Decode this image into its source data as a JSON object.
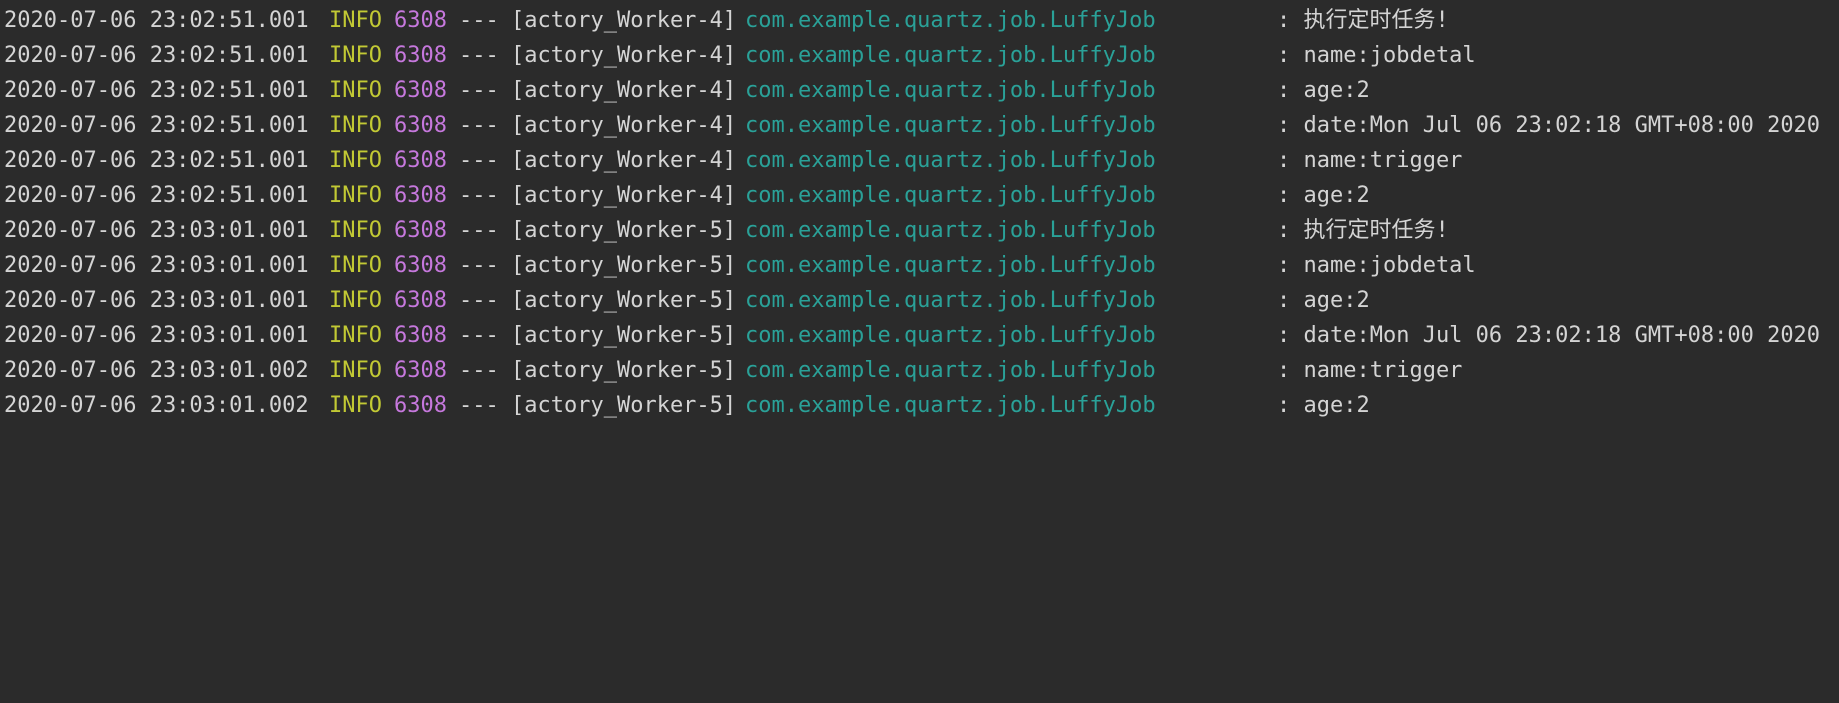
{
  "colors": {
    "background": "#2b2b2b",
    "text": "#d4d4d4",
    "level_info": "#c2c934",
    "pid": "#c678dd",
    "logger": "#2aa198"
  },
  "log_lines": [
    {
      "timestamp": "2020-07-06 23:02:51.001",
      "level": "INFO",
      "pid": "6308",
      "separator": "---",
      "thread": "[actory_Worker-4]",
      "logger": "com.example.quartz.job.LuffyJob",
      "message": ": 执行定时任务!"
    },
    {
      "timestamp": "2020-07-06 23:02:51.001",
      "level": "INFO",
      "pid": "6308",
      "separator": "---",
      "thread": "[actory_Worker-4]",
      "logger": "com.example.quartz.job.LuffyJob",
      "message": ": name:jobdetal"
    },
    {
      "timestamp": "2020-07-06 23:02:51.001",
      "level": "INFO",
      "pid": "6308",
      "separator": "---",
      "thread": "[actory_Worker-4]",
      "logger": "com.example.quartz.job.LuffyJob",
      "message": ": age:2"
    },
    {
      "timestamp": "2020-07-06 23:02:51.001",
      "level": "INFO",
      "pid": "6308",
      "separator": "---",
      "thread": "[actory_Worker-4]",
      "logger": "com.example.quartz.job.LuffyJob",
      "message": ": date:Mon Jul 06 23:02:18 GMT+08:00 2020"
    },
    {
      "timestamp": "2020-07-06 23:02:51.001",
      "level": "INFO",
      "pid": "6308",
      "separator": "---",
      "thread": "[actory_Worker-4]",
      "logger": "com.example.quartz.job.LuffyJob",
      "message": ": name:trigger"
    },
    {
      "timestamp": "2020-07-06 23:02:51.001",
      "level": "INFO",
      "pid": "6308",
      "separator": "---",
      "thread": "[actory_Worker-4]",
      "logger": "com.example.quartz.job.LuffyJob",
      "message": ": age:2"
    },
    {
      "timestamp": "2020-07-06 23:03:01.001",
      "level": "INFO",
      "pid": "6308",
      "separator": "---",
      "thread": "[actory_Worker-5]",
      "logger": "com.example.quartz.job.LuffyJob",
      "message": ": 执行定时任务!"
    },
    {
      "timestamp": "2020-07-06 23:03:01.001",
      "level": "INFO",
      "pid": "6308",
      "separator": "---",
      "thread": "[actory_Worker-5]",
      "logger": "com.example.quartz.job.LuffyJob",
      "message": ": name:jobdetal"
    },
    {
      "timestamp": "2020-07-06 23:03:01.001",
      "level": "INFO",
      "pid": "6308",
      "separator": "---",
      "thread": "[actory_Worker-5]",
      "logger": "com.example.quartz.job.LuffyJob",
      "message": ": age:2"
    },
    {
      "timestamp": "2020-07-06 23:03:01.001",
      "level": "INFO",
      "pid": "6308",
      "separator": "---",
      "thread": "[actory_Worker-5]",
      "logger": "com.example.quartz.job.LuffyJob",
      "message": ": date:Mon Jul 06 23:02:18 GMT+08:00 2020"
    },
    {
      "timestamp": "2020-07-06 23:03:01.002",
      "level": "INFO",
      "pid": "6308",
      "separator": "---",
      "thread": "[actory_Worker-5]",
      "logger": "com.example.quartz.job.LuffyJob",
      "message": ": name:trigger"
    },
    {
      "timestamp": "2020-07-06 23:03:01.002",
      "level": "INFO",
      "pid": "6308",
      "separator": "---",
      "thread": "[actory_Worker-5]",
      "logger": "com.example.quartz.job.LuffyJob",
      "message": ": age:2"
    }
  ]
}
